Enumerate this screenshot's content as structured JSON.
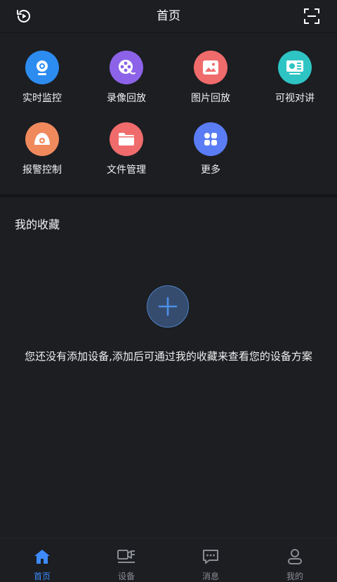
{
  "header": {
    "title": "首页"
  },
  "grid": [
    {
      "label": "实时监控",
      "icon": "camera-icon",
      "color": "#2d8cf0"
    },
    {
      "label": "录像回放",
      "icon": "film-reel-icon",
      "color": "#8c63e8"
    },
    {
      "label": "图片回放",
      "icon": "image-icon",
      "color": "#f06b6b"
    },
    {
      "label": "可视对讲",
      "icon": "intercom-icon",
      "color": "#2fc4c4"
    },
    {
      "label": "报警控制",
      "icon": "alarm-icon",
      "color": "#f08a5d"
    },
    {
      "label": "文件管理",
      "icon": "folder-icon",
      "color": "#f06b6b"
    },
    {
      "label": "更多",
      "icon": "more-grid-icon",
      "color": "#5a7cf5"
    }
  ],
  "favorites": {
    "title": "我的收藏",
    "empty_text": "您还没有添加设备,添加后可通过我的收藏来查看您的设备方案"
  },
  "tabs": [
    {
      "label": "首页",
      "icon": "home-icon",
      "active": true
    },
    {
      "label": "设备",
      "icon": "device-icon",
      "active": false
    },
    {
      "label": "消息",
      "icon": "message-icon",
      "active": false
    },
    {
      "label": "我的",
      "icon": "profile-icon",
      "active": false
    }
  ],
  "colors": {
    "accent": "#3d8bff",
    "background": "#1c1e22",
    "inactive": "#8a8d93"
  }
}
